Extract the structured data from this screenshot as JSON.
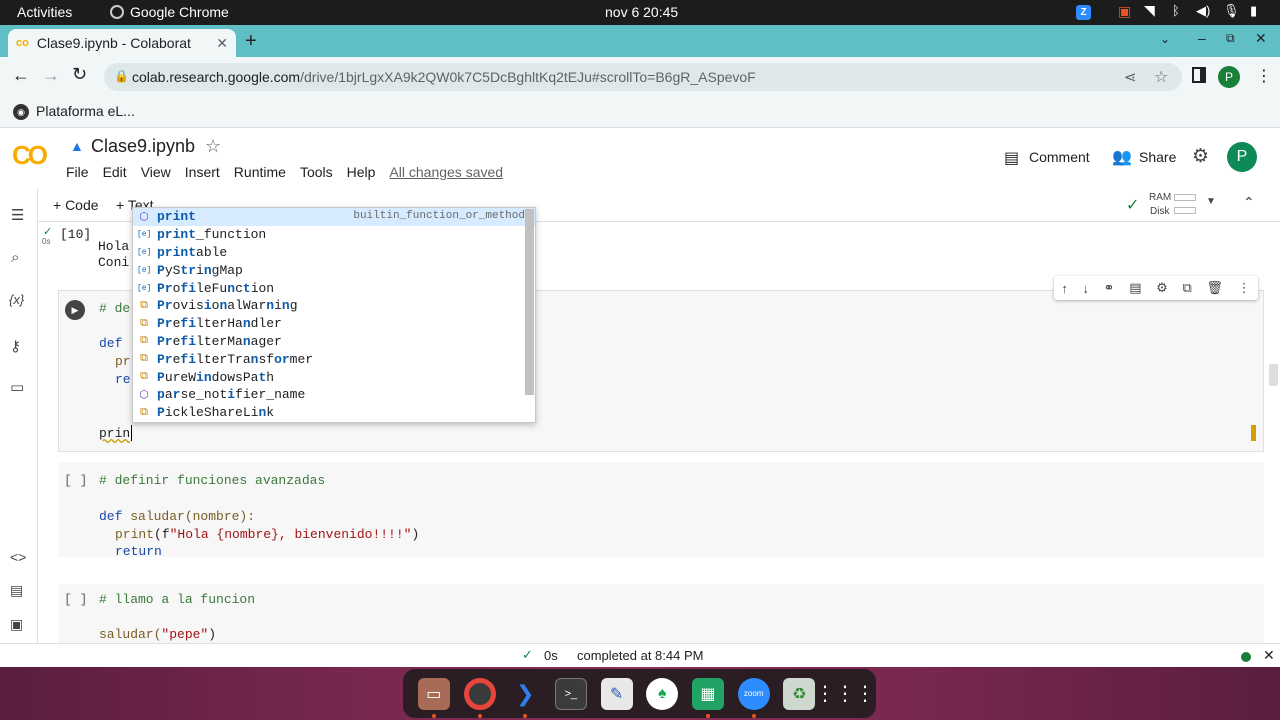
{
  "system": {
    "activities": "Activities",
    "app_name": "Google Chrome",
    "clock": "nov 6  20:45"
  },
  "browser": {
    "tab_title": "Clase9.ipynb - Colaborat",
    "url_host": "colab.research.google.com",
    "url_path": "/drive/1bjrLgxXA9k2QW0k7C5DcBghltKq2tEJu#scrollTo=B6gR_ASpevoF",
    "bookmark": "Plataforma eL...",
    "profile_initial": "P"
  },
  "colab": {
    "logo": "CO",
    "notebook_title": "Clase9.ipynb",
    "menu": [
      "File",
      "Edit",
      "View",
      "Insert",
      "Runtime",
      "Tools",
      "Help"
    ],
    "save_status": "All changes saved",
    "comment_label": "Comment",
    "share_label": "Share",
    "user_initial": "P",
    "add_code": "+ Code",
    "add_text": "+ Text",
    "ram_label": "RAM",
    "disk_label": "Disk"
  },
  "cells": {
    "cell1": {
      "exec_count": "[10]",
      "exec_time": "0s",
      "out_line1": "Hola",
      "out_line2": "Coni"
    },
    "cell2": {
      "l1": "# de",
      "l2": "def",
      "l3": "pr",
      "l4": "re",
      "current": "prin"
    },
    "cell3": {
      "bracket": "[ ]",
      "comment": "# definir funciones avanzadas",
      "def_kw": "def",
      "def_rest": "saludar(nombre):",
      "print_fn": "print",
      "print_open": "(f",
      "print_str": "\"Hola {nombre}, bienvenido!!!!\"",
      "print_close": ")",
      "return_kw": "return"
    },
    "cell4": {
      "bracket": "[ ]",
      "comment": "# llamo a la funcion",
      "call": "saludar(",
      "arg": "\"pepe\"",
      "close": ")"
    }
  },
  "autocomplete": {
    "detail": "builtin_function_or_method",
    "items": [
      {
        "icon": "cube",
        "pre": "",
        "m": "print",
        "post": ""
      },
      {
        "icon": "var",
        "pre": "",
        "m": "print",
        "post": "_function"
      },
      {
        "icon": "var",
        "pre": "",
        "m": "print",
        "post": "able"
      },
      {
        "icon": "var",
        "pre": "",
        "m": "P",
        "post": "yS",
        "m2": "tr",
        "post2": "i",
        "m3": "n",
        "post3": "gMap"
      },
      {
        "icon": "var",
        "pre": "",
        "m": "Pr",
        "post": "o",
        "m2": "fi",
        "post2": "leFu",
        "m3": "n",
        "post3": "c",
        "m4": "t",
        "post4": "ion"
      },
      {
        "icon": "class",
        "pre": "",
        "m": "Pr",
        "post": "ovis",
        "m2": "i",
        "post2": "o",
        "m3": "n",
        "post3": "alWar",
        "m4": "n",
        "post4": "i",
        "m5": "n",
        "post5": "g"
      },
      {
        "icon": "class",
        "pre": "",
        "m": "Pr",
        "post": "e",
        "m2": "fi",
        "post2": "lterHa",
        "m3": "n",
        "post3": "dler"
      },
      {
        "icon": "class",
        "pre": "",
        "m": "Pr",
        "post": "e",
        "m2": "fi",
        "post2": "lterMa",
        "m3": "n",
        "post3": "ager"
      },
      {
        "icon": "class",
        "pre": "",
        "m": "Pr",
        "post": "e",
        "m2": "fi",
        "post2": "lterTra",
        "m3": "n",
        "post3": "sf",
        "m4": "or",
        "post4": "mer"
      },
      {
        "icon": "class",
        "pre": "",
        "m": "P",
        "post": "ureW",
        "m2": "in",
        "post2": "dowsPa",
        "m3": "t",
        "post3": "h"
      },
      {
        "icon": "cube",
        "pre": "",
        "m": "p",
        "post": "a",
        "m2": "r",
        "post2": "se_not",
        "m3": "i",
        "post3": "fier_name"
      },
      {
        "icon": "class",
        "pre": "",
        "m": "P",
        "post": "ickleShareLi",
        "m2": "n",
        "post2": "k"
      }
    ]
  },
  "status": {
    "time": "0s",
    "completed": "completed at 8:44 PM"
  },
  "dock": [
    "files-icon",
    "chrome-icon",
    "vscode-icon",
    "terminal-icon",
    "text-editor-icon",
    "mongodb-icon",
    "spreadsheet-icon",
    "zoom-icon",
    "trash-icon",
    "apps-grid-icon"
  ],
  "colors": {
    "tabbar": "#60bfc4",
    "colab_orange": "#f9ab00",
    "accent_green": "#0d8a55",
    "keyword_blue": "#1a48a8",
    "string_red": "#a31515"
  }
}
